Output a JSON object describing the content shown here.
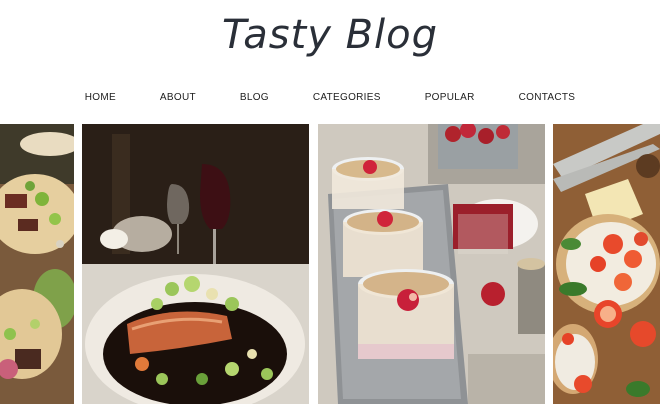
{
  "header": {
    "logo_text": "Tasty Blog"
  },
  "nav": {
    "items": [
      {
        "label": "HOME"
      },
      {
        "label": "ABOUT"
      },
      {
        "label": "BLOG"
      },
      {
        "label": "CATEGORIES"
      },
      {
        "label": "POPULAR"
      },
      {
        "label": "CONTACTS"
      }
    ]
  },
  "gallery": {
    "tiles": [
      {
        "subject": "tacos-photo"
      },
      {
        "subject": "salmon-dinner-photo"
      },
      {
        "subject": "overnight-oats-photo"
      },
      {
        "subject": "tomato-toast-photo"
      }
    ]
  }
}
